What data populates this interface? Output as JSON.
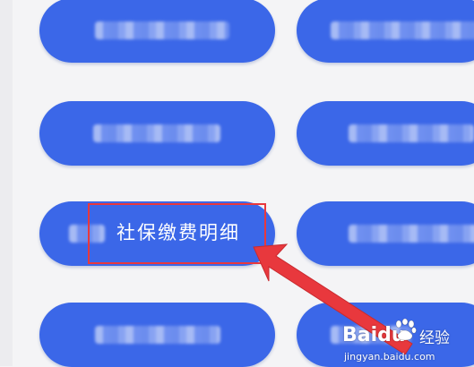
{
  "menu_items": [
    {
      "label": null,
      "state": "blurred"
    },
    {
      "label": null,
      "state": "blurred"
    },
    {
      "label": null,
      "state": "blurred"
    },
    {
      "label": null,
      "state": "blurred"
    },
    {
      "label": "社保缴费明细",
      "state": "visible"
    },
    {
      "label": null,
      "state": "blurred"
    },
    {
      "label": null,
      "state": "blurred"
    },
    {
      "label": null,
      "state": "blurred"
    }
  ],
  "highlight": {
    "target": "社保缴费明细",
    "color": "#e8383d"
  },
  "watermark": {
    "logo": "Bai",
    "logo_suffix": "du",
    "brand": "经验",
    "url": "jingyan.baidu.com"
  },
  "colors": {
    "button": "#3b67e8",
    "background": "#f4f4f6",
    "annotation": "#e8383d"
  }
}
